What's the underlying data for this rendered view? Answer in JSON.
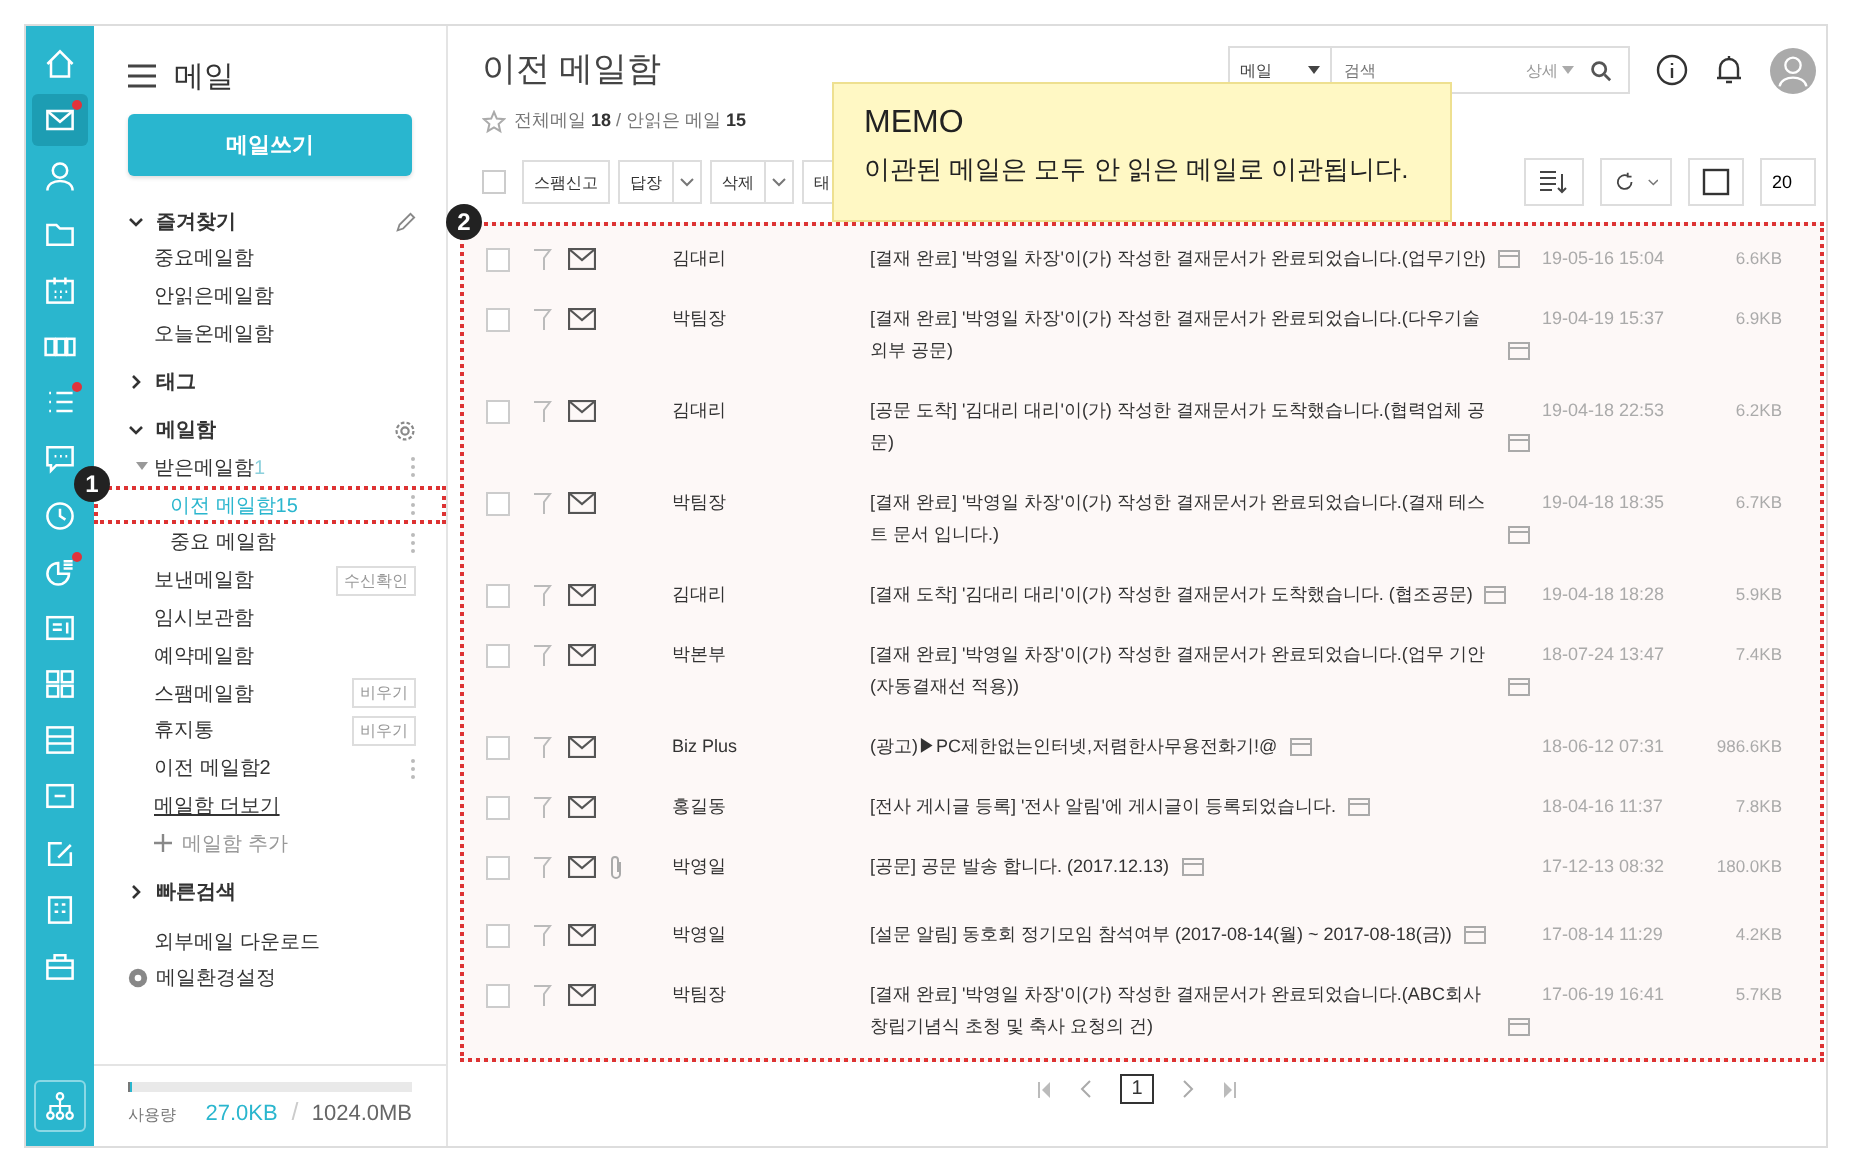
{
  "rail": [
    {
      "selected": false,
      "has_new": false
    },
    {
      "selected": true,
      "has_new": true
    },
    {
      "selected": false,
      "has_new": false
    },
    {
      "selected": false,
      "has_new": false
    },
    {
      "selected": false,
      "has_new": false
    },
    {
      "selected": false,
      "has_new": false
    },
    {
      "selected": false,
      "has_new": true
    },
    {
      "selected": false,
      "has_new": false
    },
    {
      "selected": false,
      "has_new": false
    },
    {
      "selected": false,
      "has_new": true
    },
    {
      "selected": false,
      "has_new": false
    },
    {
      "selected": false,
      "has_new": false
    },
    {
      "selected": false,
      "has_new": false
    },
    {
      "selected": false,
      "has_new": false
    },
    {
      "selected": false,
      "has_new": false
    },
    {
      "selected": false,
      "has_new": false
    },
    {
      "selected": false,
      "has_new": false
    }
  ],
  "sidebar": {
    "title": "메일",
    "compose_button": "메일쓰기",
    "sections": [
      {
        "label": "즐겨찾기",
        "expanded": true,
        "items": [
          {
            "kind": "folder",
            "label": "중요메일함",
            "selected": false
          },
          {
            "kind": "folder",
            "label": "안읽은메일함",
            "selected": false
          },
          {
            "kind": "folder",
            "label": "오늘온메일함",
            "selected": false
          }
        ]
      },
      {
        "label": "태그",
        "expanded": false
      },
      {
        "label": "메일함",
        "expanded": true,
        "items": [
          {
            "kind": "folder",
            "label": "받은메일함",
            "count": "1",
            "expanded": true,
            "menu": true,
            "selected": false,
            "children": [
              {
                "kind": "folder",
                "label": "이전 메일함",
                "count": "15",
                "menu": true,
                "selected": true,
                "annotation": "1"
              },
              {
                "kind": "folder",
                "label": "중요 메일함",
                "menu": true,
                "selected": false
              }
            ]
          },
          {
            "kind": "folder",
            "label": "보낸메일함",
            "button": "수신확인",
            "selected": false
          },
          {
            "kind": "folder",
            "label": "임시보관함",
            "selected": false
          },
          {
            "kind": "folder",
            "label": "예약메일함",
            "selected": false
          },
          {
            "kind": "folder",
            "label": "스팸메일함",
            "button": "비우기",
            "selected": false
          },
          {
            "kind": "folder",
            "label": "휴지통",
            "button": "비우기",
            "selected": false
          },
          {
            "kind": "folder",
            "label": "이전 메일함2",
            "menu": true,
            "selected": false
          },
          {
            "kind": "link",
            "label": "메일함 더보기"
          },
          {
            "kind": "add",
            "label": "메일함 추가"
          }
        ]
      },
      {
        "label": "빠른검색",
        "expanded": false
      }
    ],
    "links": [
      {
        "kind": "plain",
        "label": "외부메일 다운로드"
      },
      {
        "kind": "settings",
        "label": "메일환경설정"
      }
    ],
    "usage": {
      "label": "사용량",
      "used": "27.0KB",
      "total": "1024.0MB",
      "level": 0.01
    }
  },
  "header": {
    "title": "이전 메일함",
    "counts": "전체메일 **18** / 안읽은 메일 **15**",
    "search": {
      "scope": "메일",
      "placeholder": "검색",
      "detail": "상세"
    }
  },
  "toolbar": {
    "select_all": false,
    "buttons": [
      {
        "label": "스팸신고",
        "dropdown": false
      },
      {
        "label": "답장",
        "dropdown": true
      },
      {
        "label": "삭제",
        "dropdown": true
      },
      {
        "label": "태",
        "dropdown": false
      }
    ],
    "page_size": "20"
  },
  "list_annotation": "2",
  "mails": [
    {
      "checked": false,
      "read": false,
      "attachment": false,
      "sender": "김대리",
      "subject": "[결재 완료] '박영일 차장'이(가) 작성한 결재문서가 완료되었습니다.(업무기안)",
      "date": "19-05-16 15:04",
      "size": "6.6KB"
    },
    {
      "checked": false,
      "read": false,
      "attachment": false,
      "sender": "박팀장",
      "subject": "[결재 완료] '박영일 차장'이(가) 작성한 결재문서가 완료되었습니다.(다우기술 외부 공문)",
      "date": "19-04-19 15:37",
      "size": "6.9KB"
    },
    {
      "checked": false,
      "read": false,
      "attachment": false,
      "sender": "김대리",
      "subject": "[공문 도착] '김대리 대리'이(가) 작성한 결재문서가 도착했습니다.(협력업체 공문)",
      "date": "19-04-18 22:53",
      "size": "6.2KB"
    },
    {
      "checked": false,
      "read": false,
      "attachment": false,
      "sender": "박팀장",
      "subject": "[결재 완료] '박영일 차장'이(가) 작성한 결재문서가 완료되었습니다.(결재 테스트 문서 입니다.)",
      "date": "19-04-18 18:35",
      "size": "6.7KB"
    },
    {
      "checked": false,
      "read": false,
      "attachment": false,
      "sender": "김대리",
      "subject": "[결재 도착] '김대리 대리'이(가) 작성한 결재문서가 도착했습니다. (협조공문)",
      "date": "19-04-18 18:28",
      "size": "5.9KB"
    },
    {
      "checked": false,
      "read": false,
      "attachment": false,
      "sender": "박본부",
      "subject": "[결재 완료] '박영일 차장'이(가) 작성한 결재문서가 완료되었습니다.(업무 기안(자동결재선 적용))",
      "date": "18-07-24 13:47",
      "size": "7.4KB"
    },
    {
      "checked": false,
      "read": false,
      "attachment": false,
      "sender": "Biz Plus",
      "subject": "(광고)▶PC제한없는인터넷,저렴한사무용전화기!@",
      "date": "18-06-12 07:31",
      "size": "986.6KB"
    },
    {
      "checked": false,
      "read": false,
      "attachment": false,
      "sender": "홍길동",
      "subject": "[전사 게시글 등록] '전사 알림'에 게시글이 등록되었습니다.",
      "date": "18-04-16 11:37",
      "size": "7.8KB"
    },
    {
      "checked": false,
      "read": false,
      "attachment": true,
      "sender": "박영일",
      "subject": "[공문] 공문 발송 합니다. (2017.12.13)",
      "date": "17-12-13 08:32",
      "size": "180.0KB"
    },
    {
      "checked": false,
      "read": false,
      "attachment": false,
      "sender": "박영일",
      "subject": "[설문 알림] 동호회 정기모임 참석여부 (2017-08-14(월) ~ 2017-08-18(금))",
      "date": "17-08-14 11:29",
      "size": "4.2KB"
    },
    {
      "checked": false,
      "read": false,
      "attachment": false,
      "sender": "박팀장",
      "subject": "[결재 완료] '박영일 차장'이(가) 작성한 결재문서가 완료되었습니다.(ABC회사 창립기념식 초청 및 축사 요청의 건)",
      "date": "17-06-19 16:41",
      "size": "5.7KB"
    }
  ],
  "pagination": {
    "pages": [
      {
        "label": "1",
        "selected": true
      }
    ]
  },
  "memo": {
    "title": "MEMO",
    "text": "이관된 메일은 모두 안 읽은 메일로 이관됩니다."
  }
}
